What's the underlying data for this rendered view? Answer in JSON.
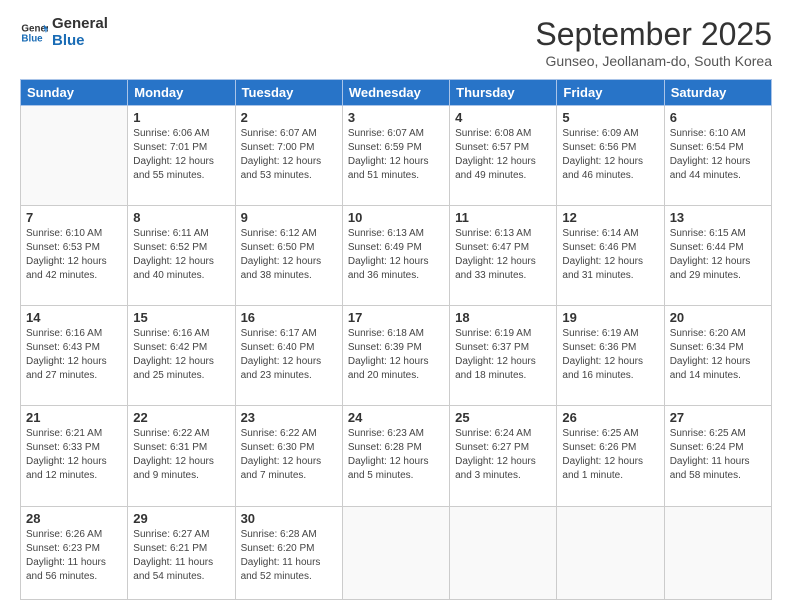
{
  "logo": {
    "line1": "General",
    "line2": "Blue"
  },
  "title": "September 2025",
  "subtitle": "Gunseo, Jeollanam-do, South Korea",
  "days_of_week": [
    "Sunday",
    "Monday",
    "Tuesday",
    "Wednesday",
    "Thursday",
    "Friday",
    "Saturday"
  ],
  "weeks": [
    [
      {
        "day": "",
        "info": ""
      },
      {
        "day": "1",
        "info": "Sunrise: 6:06 AM\nSunset: 7:01 PM\nDaylight: 12 hours\nand 55 minutes."
      },
      {
        "day": "2",
        "info": "Sunrise: 6:07 AM\nSunset: 7:00 PM\nDaylight: 12 hours\nand 53 minutes."
      },
      {
        "day": "3",
        "info": "Sunrise: 6:07 AM\nSunset: 6:59 PM\nDaylight: 12 hours\nand 51 minutes."
      },
      {
        "day": "4",
        "info": "Sunrise: 6:08 AM\nSunset: 6:57 PM\nDaylight: 12 hours\nand 49 minutes."
      },
      {
        "day": "5",
        "info": "Sunrise: 6:09 AM\nSunset: 6:56 PM\nDaylight: 12 hours\nand 46 minutes."
      },
      {
        "day": "6",
        "info": "Sunrise: 6:10 AM\nSunset: 6:54 PM\nDaylight: 12 hours\nand 44 minutes."
      }
    ],
    [
      {
        "day": "7",
        "info": "Sunrise: 6:10 AM\nSunset: 6:53 PM\nDaylight: 12 hours\nand 42 minutes."
      },
      {
        "day": "8",
        "info": "Sunrise: 6:11 AM\nSunset: 6:52 PM\nDaylight: 12 hours\nand 40 minutes."
      },
      {
        "day": "9",
        "info": "Sunrise: 6:12 AM\nSunset: 6:50 PM\nDaylight: 12 hours\nand 38 minutes."
      },
      {
        "day": "10",
        "info": "Sunrise: 6:13 AM\nSunset: 6:49 PM\nDaylight: 12 hours\nand 36 minutes."
      },
      {
        "day": "11",
        "info": "Sunrise: 6:13 AM\nSunset: 6:47 PM\nDaylight: 12 hours\nand 33 minutes."
      },
      {
        "day": "12",
        "info": "Sunrise: 6:14 AM\nSunset: 6:46 PM\nDaylight: 12 hours\nand 31 minutes."
      },
      {
        "day": "13",
        "info": "Sunrise: 6:15 AM\nSunset: 6:44 PM\nDaylight: 12 hours\nand 29 minutes."
      }
    ],
    [
      {
        "day": "14",
        "info": "Sunrise: 6:16 AM\nSunset: 6:43 PM\nDaylight: 12 hours\nand 27 minutes."
      },
      {
        "day": "15",
        "info": "Sunrise: 6:16 AM\nSunset: 6:42 PM\nDaylight: 12 hours\nand 25 minutes."
      },
      {
        "day": "16",
        "info": "Sunrise: 6:17 AM\nSunset: 6:40 PM\nDaylight: 12 hours\nand 23 minutes."
      },
      {
        "day": "17",
        "info": "Sunrise: 6:18 AM\nSunset: 6:39 PM\nDaylight: 12 hours\nand 20 minutes."
      },
      {
        "day": "18",
        "info": "Sunrise: 6:19 AM\nSunset: 6:37 PM\nDaylight: 12 hours\nand 18 minutes."
      },
      {
        "day": "19",
        "info": "Sunrise: 6:19 AM\nSunset: 6:36 PM\nDaylight: 12 hours\nand 16 minutes."
      },
      {
        "day": "20",
        "info": "Sunrise: 6:20 AM\nSunset: 6:34 PM\nDaylight: 12 hours\nand 14 minutes."
      }
    ],
    [
      {
        "day": "21",
        "info": "Sunrise: 6:21 AM\nSunset: 6:33 PM\nDaylight: 12 hours\nand 12 minutes."
      },
      {
        "day": "22",
        "info": "Sunrise: 6:22 AM\nSunset: 6:31 PM\nDaylight: 12 hours\nand 9 minutes."
      },
      {
        "day": "23",
        "info": "Sunrise: 6:22 AM\nSunset: 6:30 PM\nDaylight: 12 hours\nand 7 minutes."
      },
      {
        "day": "24",
        "info": "Sunrise: 6:23 AM\nSunset: 6:28 PM\nDaylight: 12 hours\nand 5 minutes."
      },
      {
        "day": "25",
        "info": "Sunrise: 6:24 AM\nSunset: 6:27 PM\nDaylight: 12 hours\nand 3 minutes."
      },
      {
        "day": "26",
        "info": "Sunrise: 6:25 AM\nSunset: 6:26 PM\nDaylight: 12 hours\nand 1 minute."
      },
      {
        "day": "27",
        "info": "Sunrise: 6:25 AM\nSunset: 6:24 PM\nDaylight: 11 hours\nand 58 minutes."
      }
    ],
    [
      {
        "day": "28",
        "info": "Sunrise: 6:26 AM\nSunset: 6:23 PM\nDaylight: 11 hours\nand 56 minutes."
      },
      {
        "day": "29",
        "info": "Sunrise: 6:27 AM\nSunset: 6:21 PM\nDaylight: 11 hours\nand 54 minutes."
      },
      {
        "day": "30",
        "info": "Sunrise: 6:28 AM\nSunset: 6:20 PM\nDaylight: 11 hours\nand 52 minutes."
      },
      {
        "day": "",
        "info": ""
      },
      {
        "day": "",
        "info": ""
      },
      {
        "day": "",
        "info": ""
      },
      {
        "day": "",
        "info": ""
      }
    ]
  ]
}
